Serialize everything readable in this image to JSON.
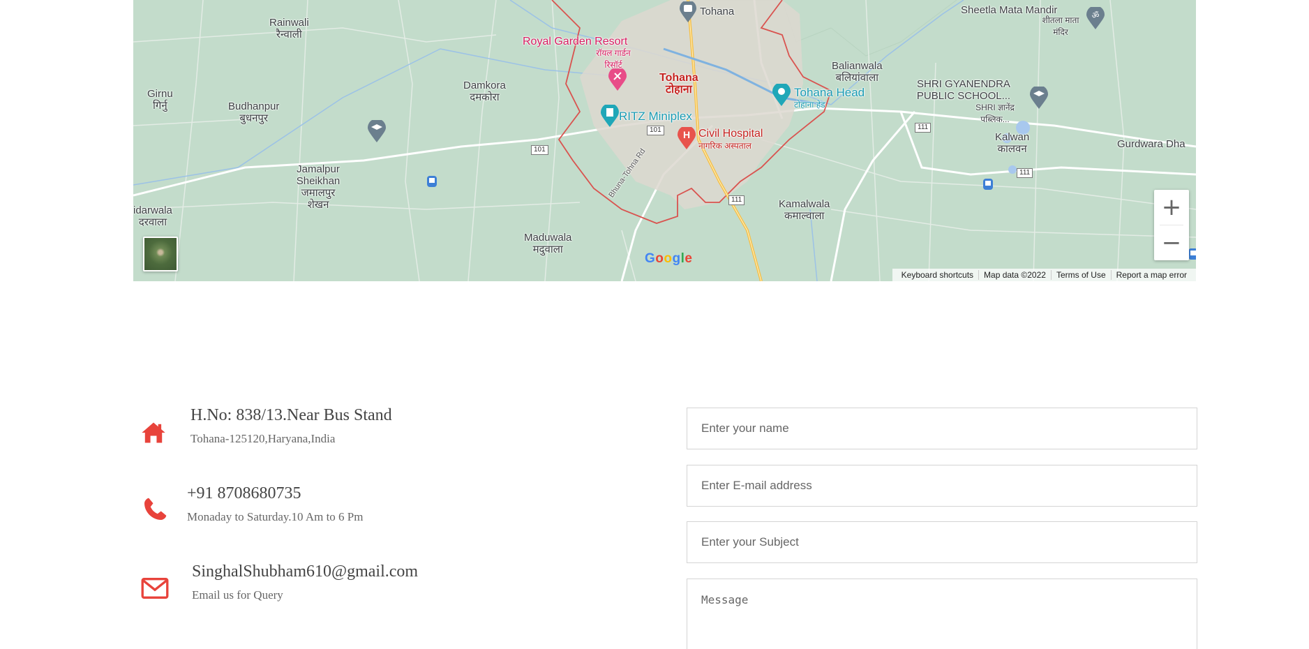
{
  "map": {
    "labels": {
      "rainwali": "Rainwali",
      "rainwali_hi": "रैन्वाली",
      "tohana_top": "Tohana",
      "royal_garden": "Royal Garden Resort",
      "royal_garden_hi": "रॉयल गार्डन रिसॉर्ट",
      "sheetla": "Sheetla Mata Mandir",
      "sheetla_hi": "शीतला माता मंदिर",
      "balianwala": "Balianwala",
      "balianwala_hi": "बलियांवाला",
      "tohana_head": "Tohana Head",
      "tohana_head_hi": "टोहाना हेड",
      "girnu": "Girnu",
      "girnu_hi": "गिर्नु",
      "damkora": "Damkora",
      "damkora_hi": "दमकोरा",
      "tohana_city": "Tohana",
      "tohana_city_hi": "टोहाना",
      "budhanpur": "Budhanpur",
      "budhanpur_hi": "बुधनपुर",
      "ritz": "RITZ Miniplex",
      "shri_school": "SHRI GYANENDRA PUBLIC SCHOOL...",
      "shri_school_hi": "SHRI ज्ञानेंद्र पब्लिक...",
      "civil_hospital": "Civil Hospital",
      "civil_hospital_hi": "नागरिक अस्पताल",
      "kalwan": "Kalwan",
      "kalwan_hi": "कालवन",
      "gurdwara": "Gurdwara Dha",
      "jamalpur": "Jamalpur Sheikhan",
      "jamalpur_hi": "जमालपुर शेखन",
      "bhuna_rd": "Bhuna-Tohna Rd",
      "sidarwala": "idarwala",
      "sidarwala_hi": "दरवाला",
      "kamalwala": "Kamalwala",
      "kamalwala_hi": "कमाल्वाला",
      "maduwala": "Maduwala",
      "maduwala_hi": "मदुवाला"
    },
    "shields": {
      "r101a": "101",
      "r101b": "101",
      "r111a": "111",
      "r111b": "111",
      "r111c": "111"
    },
    "google_logo": [
      "G",
      "o",
      "o",
      "g",
      "l",
      "e"
    ],
    "zoom_in": "+",
    "zoom_out": "−",
    "attribution": {
      "keyboard": "Keyboard shortcuts",
      "data": "Map data ©2022",
      "terms": "Terms of Use",
      "report": "Report a map error"
    }
  },
  "contact": {
    "address": {
      "icon": "home-icon",
      "title": "H.No: 838/13.Near Bus Stand",
      "sub": "Tohana-125120,Haryana,India"
    },
    "phone": {
      "icon": "phone-icon",
      "title": "+91 8708680735",
      "sub": "Monaday to Saturday.10 Am to 6 Pm"
    },
    "email": {
      "icon": "envelope-icon",
      "title": "SinghalShubham610@gmail.com",
      "sub": "Email us for Query"
    }
  },
  "form": {
    "name_placeholder": "Enter your name",
    "email_placeholder": "Enter E-mail address",
    "subject_placeholder": "Enter your Subject",
    "message_placeholder": "Message"
  },
  "colors": {
    "accent_red": "#e8433b",
    "map_bg": "#c3dccb"
  }
}
